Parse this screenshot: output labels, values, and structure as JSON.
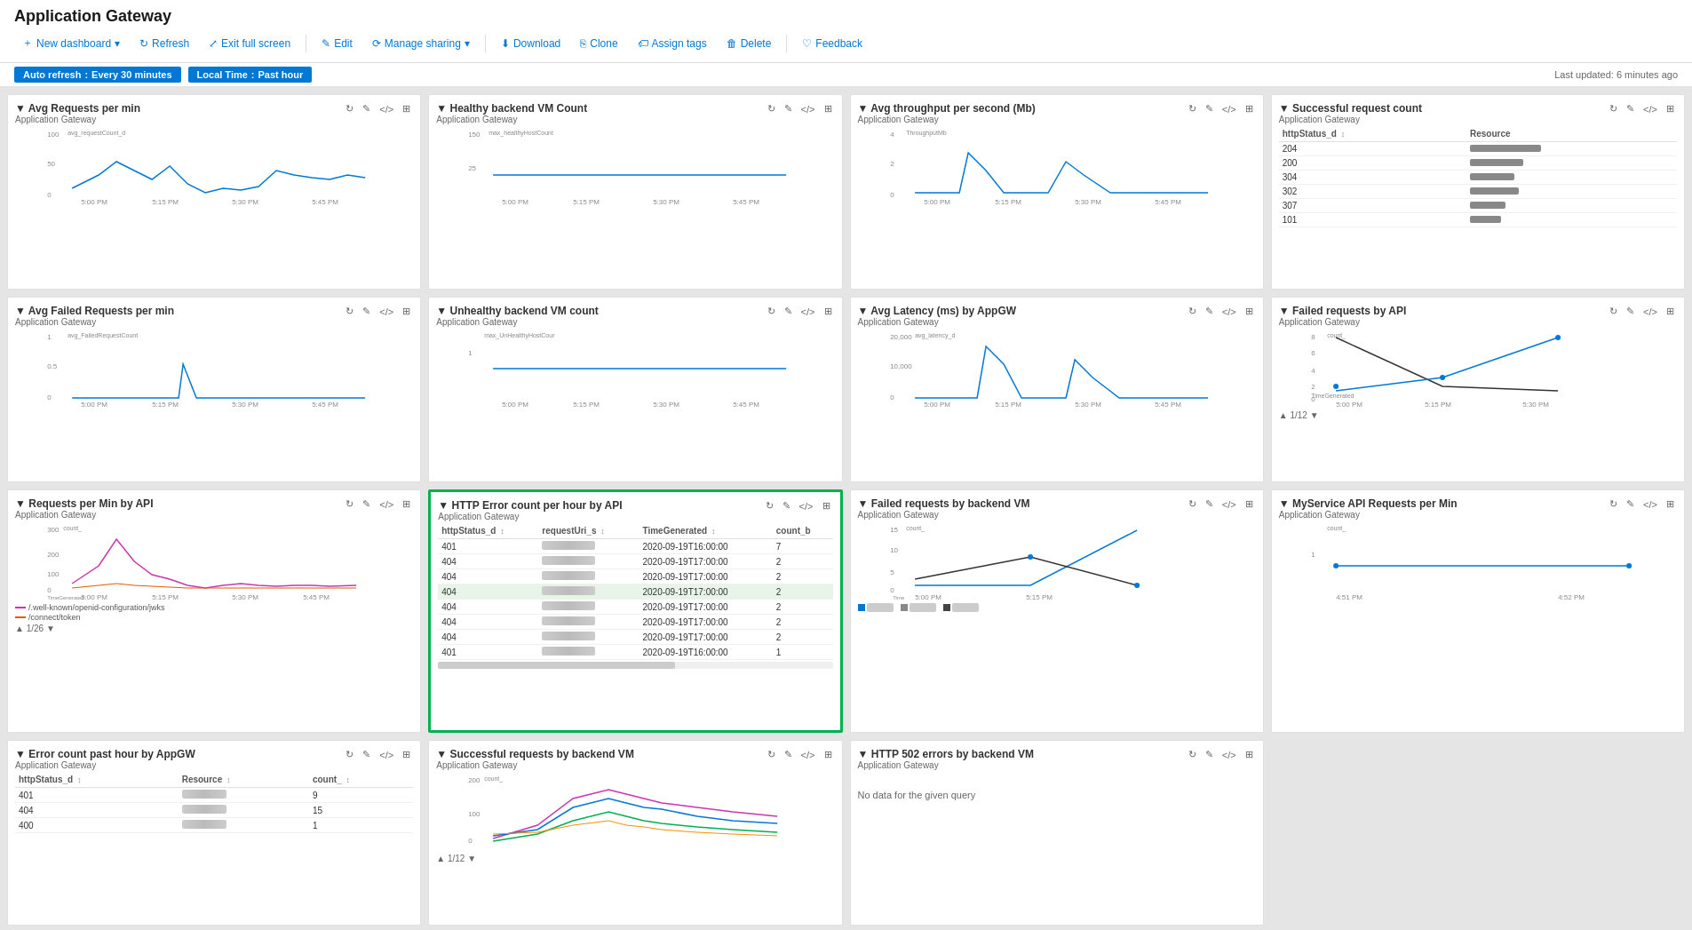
{
  "app": {
    "title": "Application Gateway"
  },
  "toolbar": {
    "new_dashboard": "New dashboard",
    "refresh": "Refresh",
    "exit_full_screen": "Exit full screen",
    "edit": "Edit",
    "manage_sharing": "Manage sharing",
    "download": "Download",
    "clone": "Clone",
    "assign_tags": "Assign tags",
    "delete": "Delete",
    "feedback": "Feedback"
  },
  "sub_toolbar": {
    "auto_refresh_label": "Auto refresh",
    "auto_refresh_value": "Every 30 minutes",
    "time_label": "Local Time",
    "time_value": "Past hour",
    "last_updated": "Last updated: 6 minutes ago"
  },
  "tiles": [
    {
      "id": "avg-requests",
      "title": "Avg Requests per min",
      "subtitle": "Application Gateway",
      "type": "line_chart",
      "yAxis": "avg_requestCount_d",
      "xLabels": [
        "5:00 PM",
        "5:15 PM",
        "5:30 PM",
        "5:45 PM"
      ],
      "yLabels": [
        "100",
        "50",
        "0"
      ],
      "color": "#0078d4"
    },
    {
      "id": "healthy-backend",
      "title": "Healthy backend VM Count",
      "subtitle": "Application Gateway",
      "type": "line_chart",
      "yAxis": "max_healthyHostCount",
      "xLabels": [
        "5:00 PM",
        "5:15 PM",
        "5:30 PM",
        "5:45 PM"
      ],
      "yLabels": [
        "150",
        "25"
      ],
      "color": "#0078d4"
    },
    {
      "id": "avg-throughput",
      "title": "Avg throughput per second (Mb)",
      "subtitle": "Application Gateway",
      "type": "line_chart",
      "yAxis": "ThroughputMb",
      "xLabels": [
        "5:00 PM",
        "5:15 PM",
        "5:30 PM",
        "5:45 PM"
      ],
      "yLabels": [
        "4",
        "2",
        "0"
      ],
      "color": "#0078d4"
    },
    {
      "id": "successful-request-count",
      "title": "Successful request count",
      "subtitle": "Application Gateway",
      "type": "table",
      "columns": [
        "httpStatus_d",
        "Resource"
      ],
      "rows": [
        {
          "status": "204",
          "bars": true
        },
        {
          "status": "200",
          "bars": true
        },
        {
          "status": "304",
          "bars": true
        },
        {
          "status": "302",
          "bars": true
        },
        {
          "status": "307",
          "bars": true
        },
        {
          "status": "101",
          "bars": true
        }
      ]
    },
    {
      "id": "avg-failed-requests",
      "title": "Avg Failed Requests per min",
      "subtitle": "Application Gateway",
      "type": "line_chart",
      "yAxis": "avg_FailedRequestCount",
      "xLabels": [
        "5:00 PM",
        "5:15 PM",
        "5:30 PM",
        "5:45 PM"
      ],
      "yLabels": [
        "1",
        "0.5",
        "0"
      ],
      "color": "#0078d4"
    },
    {
      "id": "unhealthy-backend",
      "title": "Unhealthy backend VM count",
      "subtitle": "Application Gateway",
      "type": "line_chart",
      "yAxis": "max_UnHealthyHostCour",
      "xLabels": [
        "5:00 PM",
        "5:15 PM",
        "5:30 PM",
        "5:45 PM"
      ],
      "yLabels": [
        "1"
      ],
      "color": "#0078d4"
    },
    {
      "id": "avg-latency",
      "title": "Avg Latency (ms) by AppGW",
      "subtitle": "Application Gateway",
      "type": "line_chart",
      "yAxis": "avg_latency_d",
      "xLabels": [
        "5:00 PM",
        "5:15 PM",
        "5:30 PM",
        "5:45 PM"
      ],
      "yLabels": [
        "20,000",
        "10,000",
        "0"
      ],
      "color": "#0078d4"
    },
    {
      "id": "failed-requests-by-api",
      "title": "Failed requests by API",
      "subtitle": "Application Gateway",
      "type": "line_chart_multi",
      "yAxis": "count_",
      "xLabels": [
        "5:00 PM",
        "5:15 PM",
        "5:30 PM"
      ],
      "yLabels": [
        "8",
        "6",
        "4",
        "2",
        "0"
      ],
      "color": "#333"
    },
    {
      "id": "requests-per-min-api",
      "title": "Requests per Min by API",
      "subtitle": "Application Gateway",
      "type": "line_chart_multi",
      "yAxis": "count_",
      "xLabels": [
        "5:00 PM",
        "5:15 PM",
        "5:30 PM",
        "5:45 PM"
      ],
      "yLabels": [
        "300",
        "200",
        "100",
        "0"
      ],
      "color": "#c837ab",
      "legend": [
        {
          "label": "/.well-known/openid-configuration/jwks",
          "color": "#c837ab"
        },
        {
          "label": "/connect/token",
          "color": "#e05c00"
        }
      ],
      "pagination": "1/26"
    },
    {
      "id": "http-error-count",
      "title": "HTTP Error count per hour by API",
      "subtitle": "Application Gateway",
      "type": "data_table",
      "highlighted": true,
      "columns": [
        "httpStatus_d",
        "requestUri_s",
        "TimeGenerated",
        "count_b"
      ],
      "rows": [
        {
          "status": "401",
          "uri": "blurred",
          "time": "2020-09-19T16:00:00",
          "count": "7"
        },
        {
          "status": "404",
          "uri": "blurred",
          "time": "2020-09-19T17:00:00",
          "count": "2"
        },
        {
          "status": "404",
          "uri": "blurred",
          "time": "2020-09-19T17:00:00",
          "count": "2"
        },
        {
          "status": "404",
          "uri": "blurred",
          "time": "2020-09-19T17:00:00",
          "count": "2"
        },
        {
          "status": "404",
          "uri": "blurred",
          "time": "2020-09-19T17:00:00",
          "count": "2"
        },
        {
          "status": "404",
          "uri": "blurred",
          "time": "2020-09-19T17:00:00",
          "count": "2"
        },
        {
          "status": "404",
          "uri": "blurred",
          "time": "2020-09-19T17:00:00",
          "count": "2"
        },
        {
          "status": "401",
          "uri": "blurred",
          "time": "2020-09-19T16:00:00",
          "count": "1"
        }
      ]
    },
    {
      "id": "failed-requests-backend-vm",
      "title": "Failed requests by backend VM",
      "subtitle": "Application Gateway",
      "type": "line_chart_cross",
      "yAxis": "count_",
      "xLabels": [
        "5:00 PM",
        "5:15 PM"
      ],
      "yLabels": [
        "15",
        "10",
        "5",
        "0"
      ]
    },
    {
      "id": "myservice-api-requests",
      "title": "MyService API Requests per Min",
      "subtitle": "Application Gateway",
      "type": "line_chart",
      "yAxis": "count_",
      "xLabels": [
        "4:51 PM",
        "4:52 PM"
      ],
      "yLabels": [
        "1"
      ],
      "color": "#0078d4"
    },
    {
      "id": "error-count-past-hour",
      "title": "Error count past hour by AppGW",
      "subtitle": "Application Gateway",
      "type": "data_table",
      "columns": [
        "httpStatus_d",
        "Resource",
        "count_"
      ],
      "rows": [
        {
          "status": "401",
          "resource": "blurred",
          "count": "9"
        },
        {
          "status": "404",
          "resource": "blurred",
          "count": "15"
        },
        {
          "status": "400",
          "resource": "blurred",
          "count": "1"
        }
      ]
    },
    {
      "id": "successful-requests-backend",
      "title": "Successful requests by backend VM",
      "subtitle": "Application Gateway",
      "type": "line_chart_multi",
      "yAxis": "count_",
      "xLabels": [],
      "yLabels": [
        "200",
        "100",
        "0"
      ],
      "pagination": "1/12"
    },
    {
      "id": "http-502-errors",
      "title": "HTTP 502 errors by backend VM",
      "subtitle": "Application Gateway",
      "type": "no_data",
      "message": "No data for the given query"
    }
  ]
}
